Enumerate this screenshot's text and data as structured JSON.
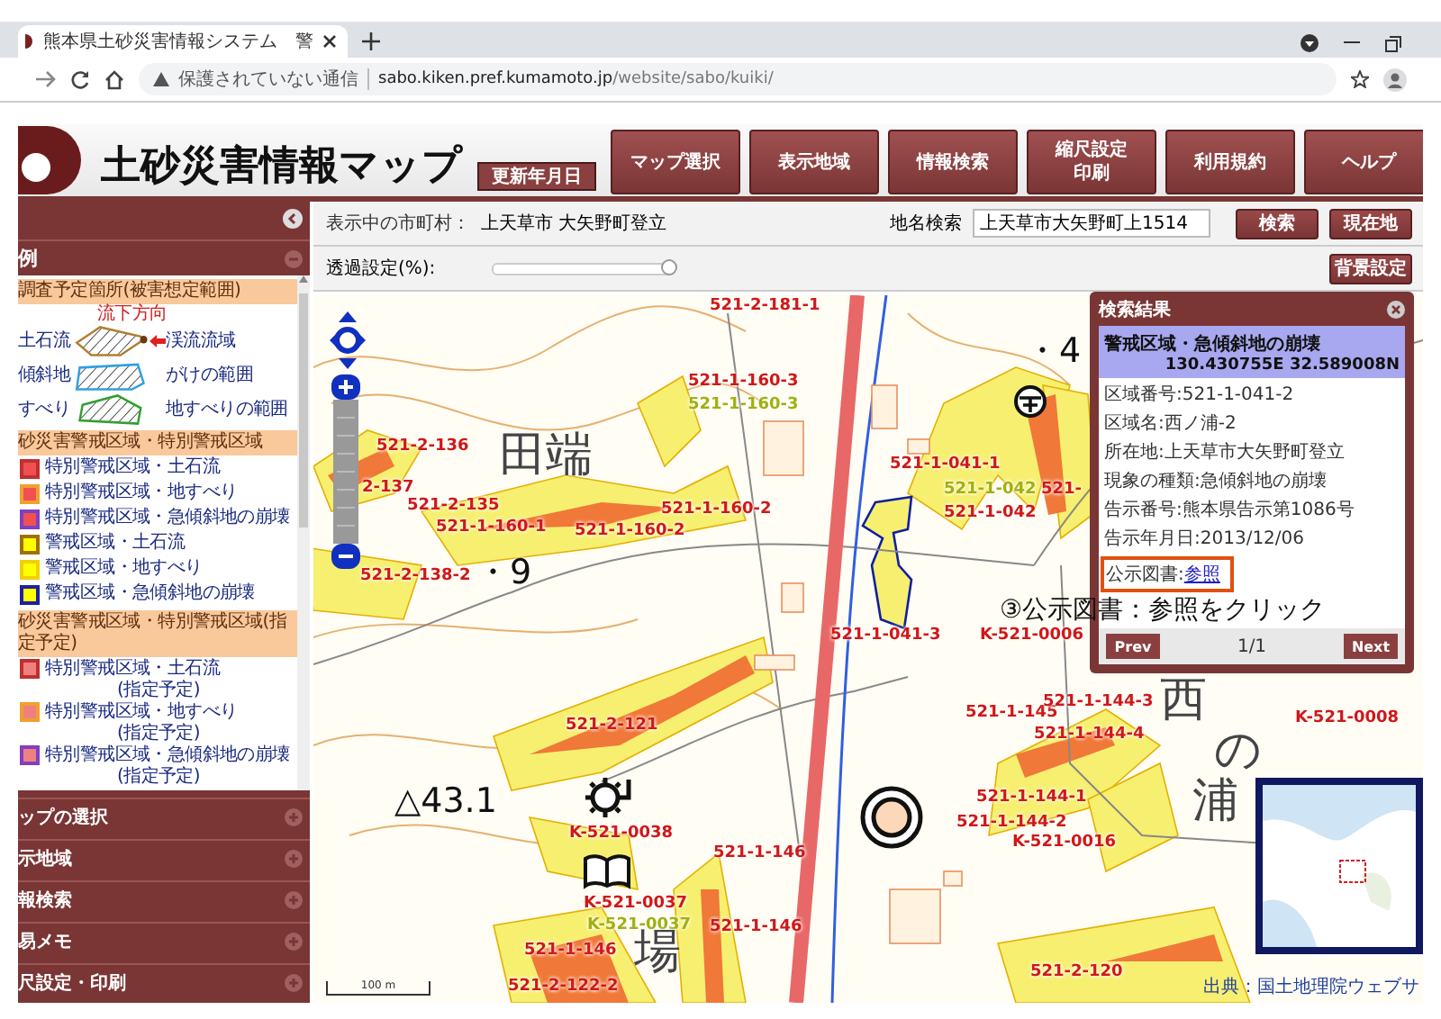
{
  "browser": {
    "tab_title": "熊本県土砂災害情報システム　警",
    "security": "保護されていない通信",
    "url_host": "sabo.kiken.pref.kumamoto.jp",
    "url_path": "/website/sabo/kuiki/"
  },
  "header": {
    "title": "土砂災害情報マップ",
    "update_button": "更新年月日",
    "nav": [
      {
        "lines": [
          "マップ選択"
        ]
      },
      {
        "lines": [
          "表示地域"
        ]
      },
      {
        "lines": [
          "情報検索"
        ]
      },
      {
        "lines": [
          "縮尺設定",
          "印刷"
        ]
      },
      {
        "lines": [
          "利用規約"
        ]
      },
      {
        "lines": [
          "ヘルプ"
        ]
      }
    ]
  },
  "sidebar": {
    "legend": {
      "title": "例",
      "expanded": true,
      "groups": [
        {
          "title": "調査予定箇所(被害想定範囲)",
          "items": [
            {
              "kind": "debris",
              "label": "土石流",
              "color": "#b08030",
              "note": "流下方向",
              "area": "渓流流域"
            },
            {
              "kind": "slope",
              "label": "傾斜地",
              "color": "#30a0e0",
              "area": "がけの範囲"
            },
            {
              "kind": "landslide",
              "label": "すべり",
              "color": "#30a030",
              "area": "地すべりの範囲"
            }
          ]
        },
        {
          "title": "砂災害警戒区域・特別警戒区域",
          "items": [
            {
              "kind": "special",
              "label": "特別警戒区域・土石流",
              "color": "#c03030"
            },
            {
              "kind": "special",
              "label": "特別警戒区域・地すべり",
              "color": "#f0a030"
            },
            {
              "kind": "special",
              "label": "特別警戒区域・急傾斜地の崩壊",
              "color": "#8040c0"
            },
            {
              "kind": "warning",
              "label": "警戒区域・土石流",
              "color": "#a07000"
            },
            {
              "kind": "warning",
              "label": "警戒区域・地すべり",
              "color": "#f0d000"
            },
            {
              "kind": "warning",
              "label": "警戒区域・急傾斜地の崩壊",
              "color": "#2020a0"
            }
          ]
        },
        {
          "title": "砂災害警戒区域・特別警戒区域(指定予定)",
          "items": [
            {
              "kind": "planned",
              "label": "特別警戒区域・土石流",
              "sub": "(指定予定)",
              "color": "#c03030"
            },
            {
              "kind": "planned",
              "label": "特別警戒区域・地すべり",
              "sub": "(指定予定)",
              "color": "#f0a030"
            },
            {
              "kind": "planned",
              "label": "特別警戒区域・急傾斜地の崩壊",
              "sub": "(指定予定)",
              "color": "#8040c0"
            }
          ]
        }
      ]
    },
    "sections": [
      {
        "label": "ップの選択",
        "expanded": false
      },
      {
        "label": "示地域",
        "expanded": false
      },
      {
        "label": "報検索",
        "expanded": false
      },
      {
        "label": "易メモ",
        "expanded": false
      },
      {
        "label": "尺設定・印刷",
        "expanded": false
      }
    ]
  },
  "toolbar": {
    "city_label": "表示中の市町村：",
    "city": "上天草市 大矢野町登立",
    "search_label": "地名検索",
    "search_value": "上天草市大矢野町上1514",
    "buttons": [
      "検索",
      "現在地"
    ],
    "opacity_label": "透過設定(%):",
    "opacity": {
      "level": 0.98
    },
    "background_button": "背景設定"
  },
  "map": {
    "labels": [
      {
        "text": "521-2-181-1",
        "kind": "zone"
      },
      {
        "text": "・4",
        "kind": "point"
      },
      {
        "text": "521-1-160-3",
        "kind": "zone"
      },
      {
        "text": "521-1-160-3",
        "kind": "alt"
      },
      {
        "text": "521-2-136",
        "kind": "zone"
      },
      {
        "text": "田端",
        "kind": "place"
      },
      {
        "text": "521-1-041-1",
        "kind": "zone"
      },
      {
        "text": "2-137",
        "kind": "zone"
      },
      {
        "text": "521-2-135",
        "kind": "zone"
      },
      {
        "text": "521-1-160-1",
        "kind": "zone"
      },
      {
        "text": "521-1-160-2",
        "kind": "zone"
      },
      {
        "text": "521-1-160-2",
        "kind": "zone"
      },
      {
        "text": "521-1-042",
        "kind": "alt"
      },
      {
        "text": "521-1-042",
        "kind": "zone"
      },
      {
        "text": "521-",
        "kind": "zone"
      },
      {
        "text": "521-2-138-2",
        "kind": "zone"
      },
      {
        "text": "・9",
        "kind": "point"
      },
      {
        "text": "521-1-041-3",
        "kind": "zone"
      },
      {
        "text": "K-521-0006",
        "kind": "zone"
      },
      {
        "text": "521-2-121",
        "kind": "zone"
      },
      {
        "text": "521-1-145",
        "kind": "zone"
      },
      {
        "text": "521-1-144-3",
        "kind": "zone"
      },
      {
        "text": "西",
        "kind": "place"
      },
      {
        "text": "521-1-144-4",
        "kind": "zone"
      },
      {
        "text": "の",
        "kind": "place"
      },
      {
        "text": "K-521-0008",
        "kind": "zone"
      },
      {
        "text": "△43.1",
        "kind": "point"
      },
      {
        "text": "K-521-0038",
        "kind": "zone"
      },
      {
        "text": "521-1-144-1",
        "kind": "zone"
      },
      {
        "text": "521-1-144-2",
        "kind": "zone"
      },
      {
        "text": "浦",
        "kind": "place"
      },
      {
        "text": "521-1-146",
        "kind": "zone"
      },
      {
        "text": "K-521-0016",
        "kind": "zone"
      },
      {
        "text": "K-521-0037",
        "kind": "zone"
      },
      {
        "text": "K-521-0037",
        "kind": "alt"
      },
      {
        "text": "521-1-146",
        "kind": "zone"
      },
      {
        "text": "場",
        "kind": "place"
      },
      {
        "text": "521-1-146",
        "kind": "zone"
      },
      {
        "text": "521-2-122-2",
        "kind": "zone"
      },
      {
        "text": "521-2-120",
        "kind": "zone"
      }
    ],
    "scale": "100 m",
    "credit": "出典：国土地理院ウェブサ"
  },
  "popup": {
    "title": "検索結果",
    "zone": "警戒区域・急傾斜地の崩壊",
    "coords": "130.430755E 32.589008N",
    "fields": [
      "区域番号:521-1-041-2",
      "区域名:西ノ浦-2",
      "所在地:上天草市大矢野町登立",
      "現象の種類:急傾斜地の崩壊",
      "告示番号:熊本県告示第1086号",
      "告示年月日:2013/12/06"
    ],
    "doc_label": "公示図書:",
    "doc_link": "参照",
    "prev": "Prev",
    "page": "1/1",
    "next": "Next"
  },
  "annotation": "③公示図書：参照をクリック"
}
